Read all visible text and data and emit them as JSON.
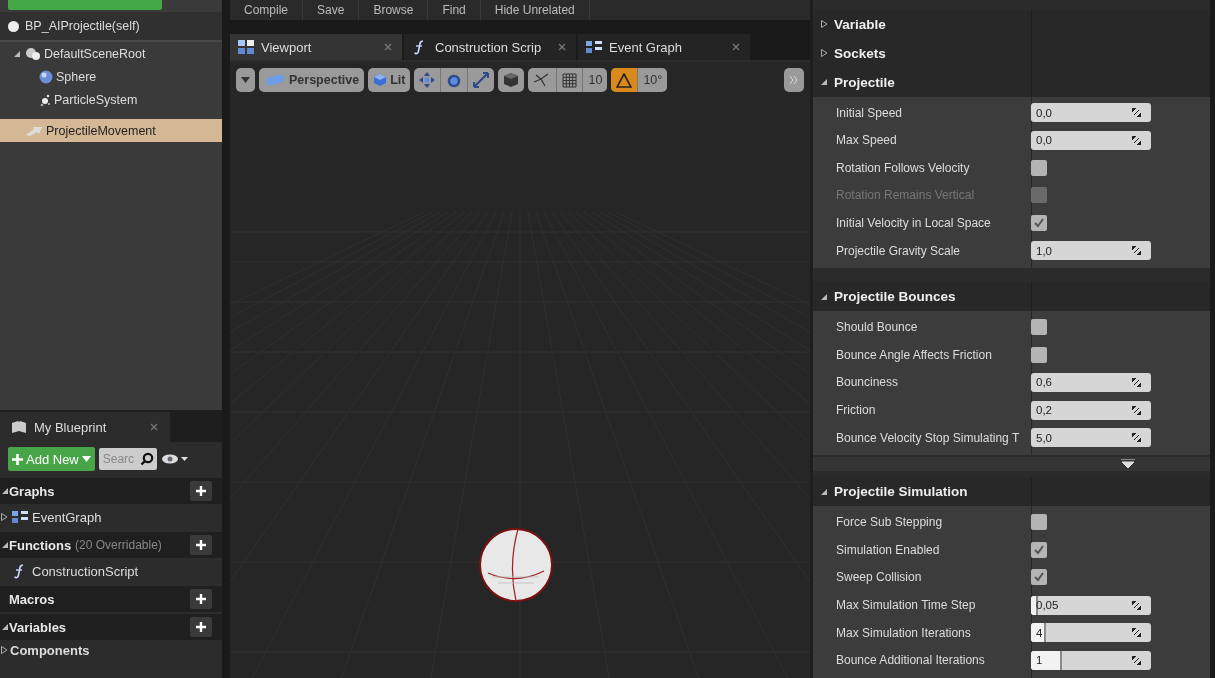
{
  "toolbar": {
    "buttons": [
      "Compile",
      "Save",
      "Browse",
      "Find",
      "Hide Unrelated"
    ]
  },
  "components": {
    "root": {
      "label": "BP_AIProjectile(self)"
    },
    "tree": [
      {
        "label": "DefaultSceneRoot",
        "kind": "scene-root",
        "expanded": true,
        "selected": false,
        "children": [
          {
            "label": "Sphere",
            "kind": "sphere",
            "selected": false
          },
          {
            "label": "ParticleSystem",
            "kind": "particles",
            "selected": false
          }
        ]
      },
      {
        "label": "ProjectileMovement",
        "kind": "movement",
        "selected": true
      }
    ]
  },
  "my_blueprint": {
    "tab": "My Blueprint",
    "add_button": "Add New",
    "search": {
      "placeholder": "Searc"
    },
    "sections": [
      {
        "title": "Graphs",
        "expanded": true,
        "items": [
          {
            "label": "EventGraph",
            "kind": "graph",
            "expanded": false
          }
        ]
      },
      {
        "title": "Functions",
        "note": "(20 Overridable)",
        "expanded": true,
        "items": [
          {
            "label": "ConstructionScript",
            "kind": "function"
          }
        ]
      },
      {
        "title": "Macros"
      },
      {
        "title": "Variables",
        "expanded": true,
        "items": [
          {
            "label": "Components",
            "kind": "category",
            "expanded": false
          }
        ]
      }
    ]
  },
  "editor": {
    "tabs": [
      {
        "label": "Viewport",
        "kind": "viewport",
        "selected": true
      },
      {
        "label": "Construction Scrip",
        "kind": "function",
        "selected": false
      },
      {
        "label": "Event Graph",
        "kind": "graph",
        "selected": false
      }
    ],
    "viewport_toolbar": {
      "view_mode": "Perspective",
      "lighting": "Lit",
      "grid_snap": "10",
      "grid_snap_on": false,
      "rotation_snap": "10°",
      "rotation_snap_on": true
    }
  },
  "details": {
    "categories": [
      {
        "title": "Variable",
        "expanded": false
      },
      {
        "title": "Sockets",
        "expanded": false
      },
      {
        "title": "Projectile",
        "expanded": true,
        "rows": [
          {
            "label": "Initial Speed",
            "kind": "number",
            "value": "0,0",
            "disabled": false
          },
          {
            "label": "Max Speed",
            "kind": "number",
            "value": "0,0",
            "disabled": false
          },
          {
            "label": "Rotation Follows Velocity",
            "kind": "check",
            "checked": false,
            "disabled": false
          },
          {
            "label": "Rotation Remains Vertical",
            "kind": "check",
            "checked": false,
            "disabled": true
          },
          {
            "label": "Initial Velocity in Local Space",
            "kind": "check",
            "checked": true,
            "disabled": false
          },
          {
            "label": "Projectile Gravity Scale",
            "kind": "number",
            "value": "1,0",
            "disabled": false
          }
        ]
      },
      {
        "title": "Projectile Bounces",
        "expanded": true,
        "advanced": true,
        "rows": [
          {
            "label": "Should Bounce",
            "kind": "check",
            "checked": false,
            "disabled": false
          },
          {
            "label": "Bounce Angle Affects Friction",
            "kind": "check",
            "checked": false,
            "disabled": false
          },
          {
            "label": "Bounciness",
            "kind": "number",
            "value": "0,6",
            "disabled": false
          },
          {
            "label": "Friction",
            "kind": "number",
            "value": "0,2",
            "disabled": false
          },
          {
            "label": "Bounce Velocity Stop Simulating T",
            "kind": "number",
            "value": "5,0",
            "disabled": false
          }
        ]
      },
      {
        "title": "Projectile Simulation",
        "expanded": true,
        "rows": [
          {
            "label": "Force Sub Stepping",
            "kind": "check",
            "checked": false,
            "disabled": false
          },
          {
            "label": "Simulation Enabled",
            "kind": "check",
            "checked": true,
            "disabled": false
          },
          {
            "label": "Sweep Collision",
            "kind": "check",
            "checked": true,
            "disabled": false
          },
          {
            "label": "Max Simulation Time Step",
            "kind": "number",
            "value": "0,05",
            "level": 0.04,
            "disabled": false
          },
          {
            "label": "Max Simulation Iterations",
            "kind": "number",
            "value": "4",
            "level": 0.11,
            "disabled": false
          },
          {
            "label": "Bounce Additional Iterations",
            "kind": "number",
            "value": "1",
            "level": 0.24,
            "disabled": false
          }
        ]
      }
    ]
  }
}
